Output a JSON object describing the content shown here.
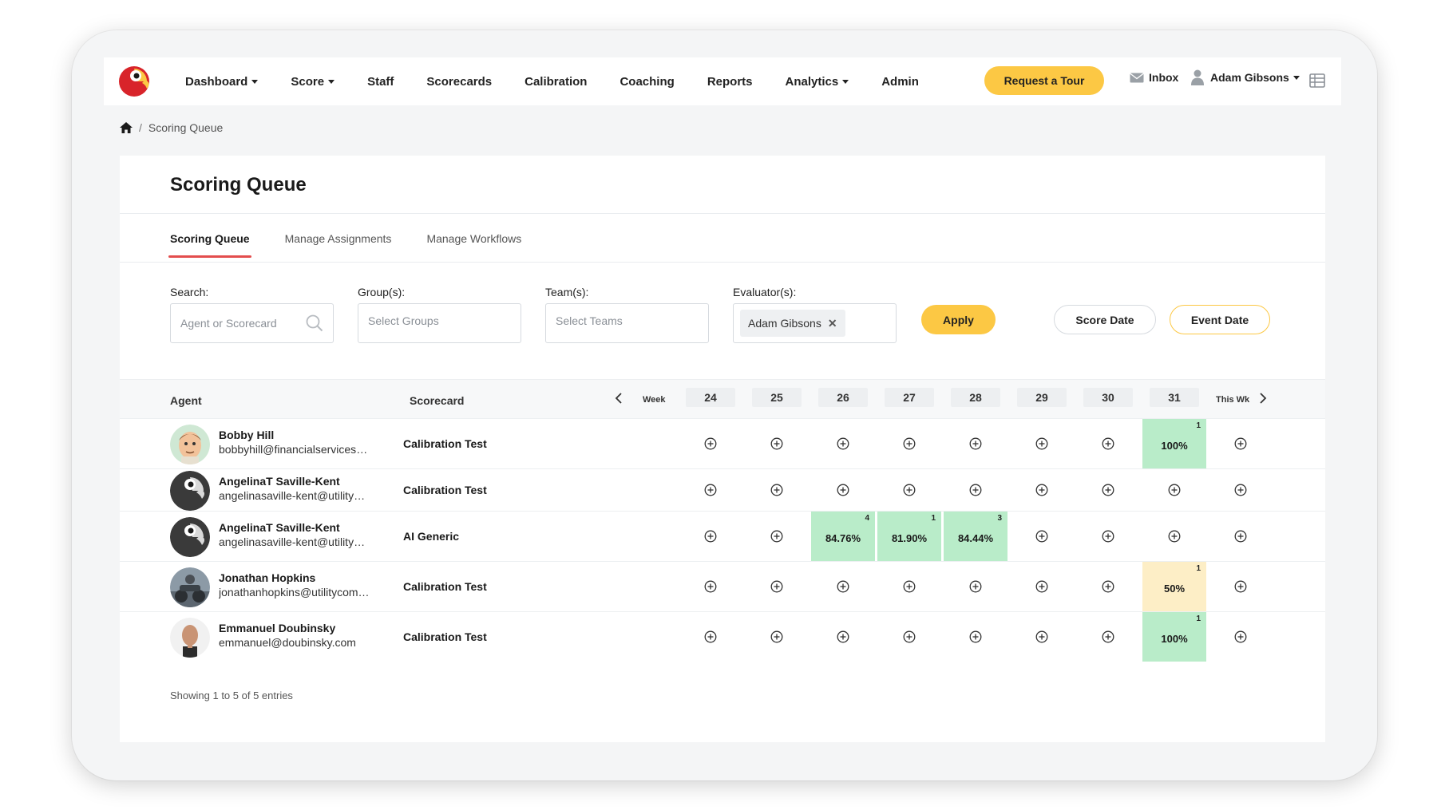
{
  "nav": {
    "items": [
      {
        "label": "Dashboard",
        "dropdown": true
      },
      {
        "label": "Score",
        "dropdown": true
      },
      {
        "label": "Staff",
        "dropdown": false
      },
      {
        "label": "Scorecards",
        "dropdown": false
      },
      {
        "label": "Calibration",
        "dropdown": false
      },
      {
        "label": "Coaching",
        "dropdown": false
      },
      {
        "label": "Reports",
        "dropdown": false
      },
      {
        "label": "Analytics",
        "dropdown": true
      },
      {
        "label": "Admin",
        "dropdown": false
      }
    ],
    "tour_label": "Request a Tour",
    "inbox_label": "Inbox",
    "user_name": "Adam Gibsons"
  },
  "breadcrumb": {
    "current": "Scoring Queue"
  },
  "page": {
    "title": "Scoring Queue"
  },
  "tabs": [
    "Scoring Queue",
    "Manage Assignments",
    "Manage Workflows"
  ],
  "filters": {
    "search_label": "Search:",
    "search_placeholder": "Agent or Scorecard",
    "groups_label": "Group(s):",
    "groups_placeholder": "Select Groups",
    "teams_label": "Team(s):",
    "teams_placeholder": "Select Teams",
    "evaluators_label": "Evaluator(s):",
    "evaluator_chip": "Adam Gibsons",
    "apply_label": "Apply",
    "score_date_label": "Score Date",
    "event_date_label": "Event Date"
  },
  "table": {
    "agent_header": "Agent",
    "scorecard_header": "Scorecard",
    "week_label": "Week",
    "this_week_label": "This Wk",
    "weeks": [
      "24",
      "25",
      "26",
      "27",
      "28",
      "29",
      "30",
      "31"
    ],
    "rows": [
      {
        "name": "Bobby Hill",
        "email": "bobbyhill@financialservices.c...",
        "scorecard": "Calibration Test",
        "cells": [
          null,
          null,
          null,
          null,
          null,
          null,
          null,
          {
            "score": "100%",
            "count": "1",
            "color": "green"
          }
        ]
      },
      {
        "name": "AngelinaT Saville-Kent",
        "email": "angelinasaville-kent@utilityco...",
        "scorecard": "Calibration Test",
        "cells": [
          null,
          null,
          null,
          null,
          null,
          null,
          null,
          null
        ]
      },
      {
        "name": "AngelinaT Saville-Kent",
        "email": "angelinasaville-kent@utilityco...",
        "scorecard": "AI Generic",
        "cells": [
          null,
          null,
          {
            "score": "84.76%",
            "count": "4",
            "color": "green"
          },
          {
            "score": "81.90%",
            "count": "1",
            "color": "green"
          },
          {
            "score": "84.44%",
            "count": "3",
            "color": "green"
          },
          null,
          null,
          null
        ]
      },
      {
        "name": "Jonathan Hopkins",
        "email": "jonathanhopkins@utilitycomp...",
        "scorecard": "Calibration Test",
        "cells": [
          null,
          null,
          null,
          null,
          null,
          null,
          null,
          {
            "score": "50%",
            "count": "1",
            "color": "yellow"
          }
        ]
      },
      {
        "name": "Emmanuel Doubinsky",
        "email": "emmanuel@doubinsky.com",
        "scorecard": "Calibration Test",
        "cells": [
          null,
          null,
          null,
          null,
          null,
          null,
          null,
          {
            "score": "100%",
            "count": "1",
            "color": "green"
          }
        ]
      }
    ],
    "footer": "Showing 1 to 5 of 5 entries"
  },
  "colors": {
    "accent": "#fcc844",
    "tab_underline": "#e34d4d",
    "score_green": "#b9ecc9",
    "score_yellow": "#fdeec6"
  }
}
